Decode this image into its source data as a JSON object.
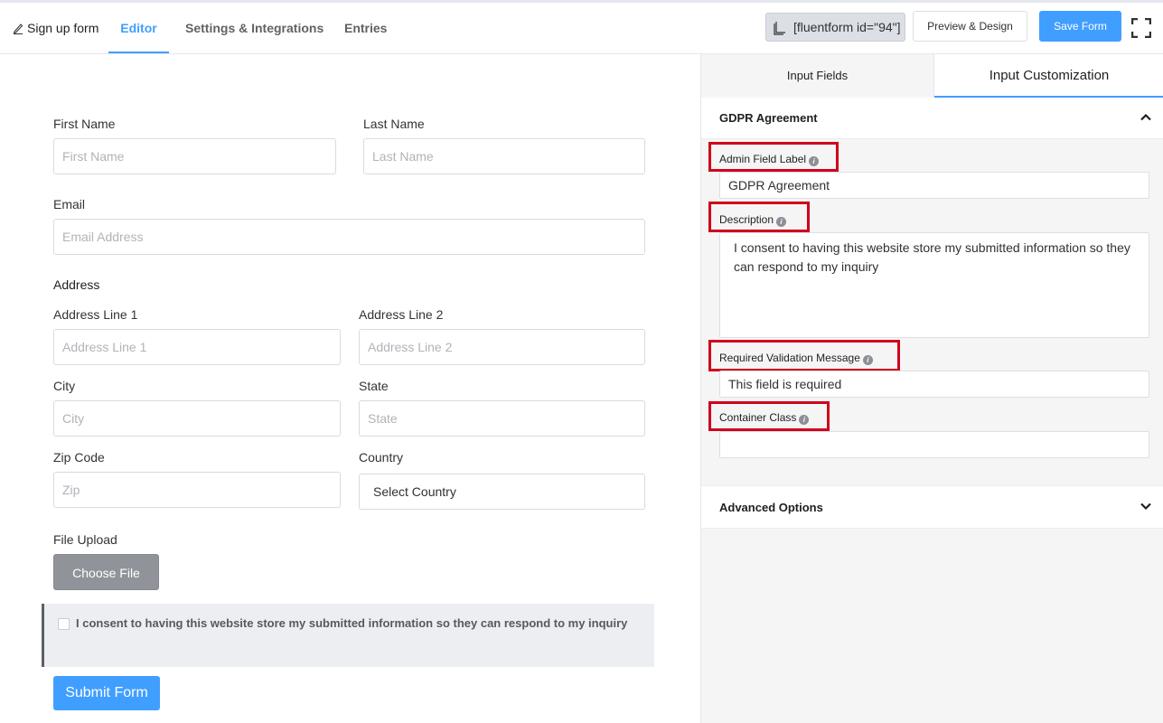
{
  "topbar": {
    "form_name": "Sign up form",
    "tabs": [
      "Editor",
      "Settings & Integrations",
      "Entries"
    ],
    "shortcode": "[fluentform id=\"94\"]",
    "preview_label": "Preview & Design",
    "save_label": "Save Form"
  },
  "form": {
    "first_name": {
      "label": "First Name",
      "placeholder": "First Name"
    },
    "last_name": {
      "label": "Last Name",
      "placeholder": "Last Name"
    },
    "email": {
      "label": "Email",
      "placeholder": "Email Address"
    },
    "address": {
      "heading": "Address",
      "line1": {
        "label": "Address Line 1",
        "placeholder": "Address Line 1"
      },
      "line2": {
        "label": "Address Line 2",
        "placeholder": "Address Line 2"
      },
      "city": {
        "label": "City",
        "placeholder": "City"
      },
      "state": {
        "label": "State",
        "placeholder": "State"
      },
      "zip": {
        "label": "Zip Code",
        "placeholder": "Zip"
      },
      "country": {
        "label": "Country",
        "value": "Select Country"
      }
    },
    "file_upload": {
      "label": "File Upload",
      "button": "Choose File"
    },
    "gdpr_text": "I consent to having this website store my submitted information so they can respond to my inquiry",
    "submit_label": "Submit Form"
  },
  "panel": {
    "tabs": [
      "Input Fields",
      "Input Customization"
    ],
    "section_title": "GDPR Agreement",
    "admin_label": {
      "label": "Admin Field Label",
      "value": "GDPR Agreement"
    },
    "description": {
      "label": "Description",
      "value": "I consent to having this website store my submitted information so they can respond to my inquiry"
    },
    "validation": {
      "label": "Required Validation Message",
      "value": "This field is required"
    },
    "container_class": {
      "label": "Container Class",
      "value": ""
    },
    "advanced": "Advanced Options"
  },
  "colors": {
    "accent": "#409eff",
    "highlight": "#d0021b"
  }
}
